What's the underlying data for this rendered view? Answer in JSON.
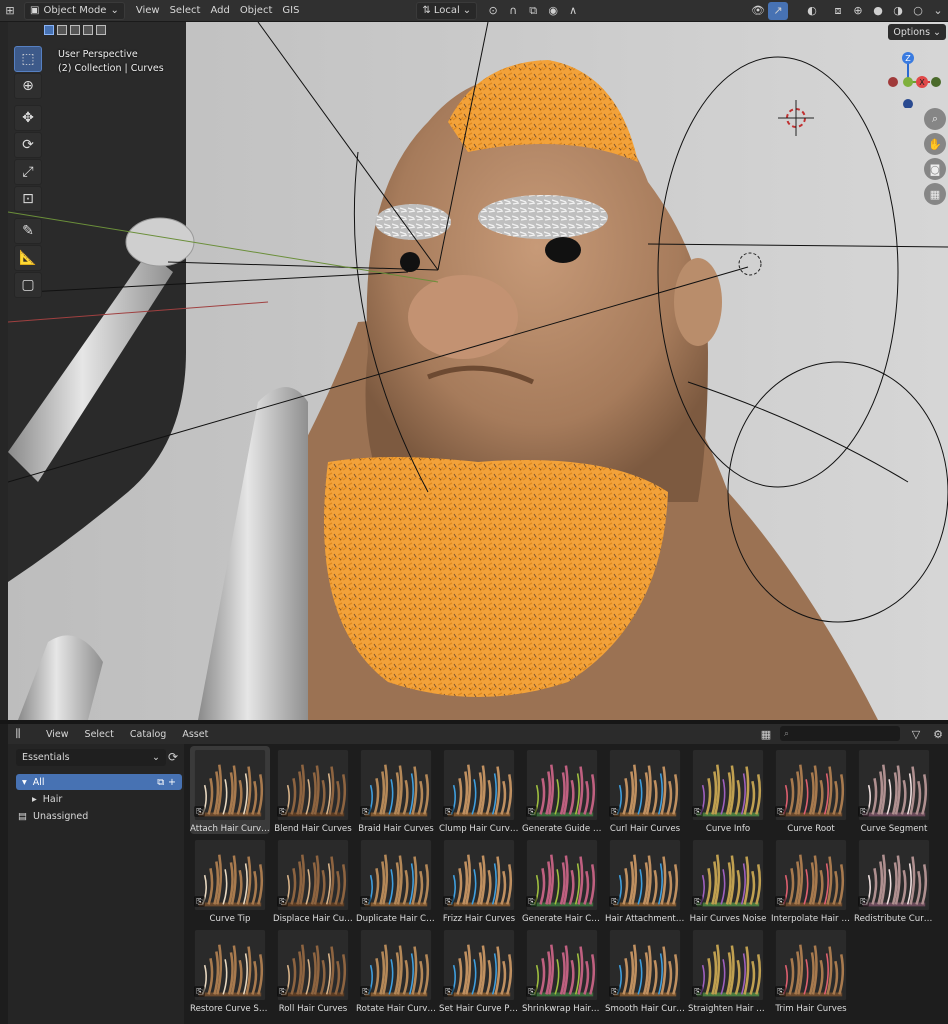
{
  "header": {
    "mode": "Object Mode",
    "menus": [
      "View",
      "Select",
      "Add",
      "Object",
      "GIS"
    ],
    "orientation": "Local"
  },
  "viewport": {
    "perspective": "User Perspective",
    "collection": "(2) Collection | Curves",
    "options_label": "Options",
    "gizmo_axes": [
      "X",
      "Y",
      "Z"
    ]
  },
  "asset_browser": {
    "menus": [
      "View",
      "Select",
      "Catalog",
      "Asset"
    ],
    "library": "Essentials",
    "catalogs": [
      {
        "label": "All",
        "active": true
      },
      {
        "label": "Hair",
        "active": false
      },
      {
        "label": "Unassigned",
        "active": false
      }
    ],
    "assets": [
      {
        "label": "Attach Hair Curves",
        "icon": "node-icon"
      },
      {
        "label": "Blend Hair Curves",
        "icon": "node-icon"
      },
      {
        "label": "Braid Hair Curves",
        "icon": "node-icon"
      },
      {
        "label": "Clump Hair Curves",
        "icon": "node-icon"
      },
      {
        "label": "Generate Guide Index",
        "icon": "node-icon"
      },
      {
        "label": "Curl Hair Curves",
        "icon": "node-icon"
      },
      {
        "label": "Curve Info",
        "icon": "node-icon"
      },
      {
        "label": "Curve Root",
        "icon": "node-icon"
      },
      {
        "label": "Curve Segment",
        "icon": "node-icon"
      },
      {
        "label": "Curve Tip",
        "icon": "node-icon"
      },
      {
        "label": "Displace Hair Curves",
        "icon": "node-icon"
      },
      {
        "label": "Duplicate Hair Curves",
        "icon": "node-icon"
      },
      {
        "label": "Frizz Hair Curves",
        "icon": "node-icon"
      },
      {
        "label": "Generate Hair Curves",
        "icon": "node-icon"
      },
      {
        "label": "Hair Attachment Info",
        "icon": "node-icon"
      },
      {
        "label": "Hair Curves Noise",
        "icon": "node-icon"
      },
      {
        "label": "Interpolate Hair Curves",
        "icon": "node-icon"
      },
      {
        "label": "Redistribute Curve Points",
        "icon": "node-icon"
      },
      {
        "label": "Restore Curve Segment Length",
        "icon": "node-icon"
      },
      {
        "label": "Roll Hair Curves",
        "icon": "node-icon"
      },
      {
        "label": "Rotate Hair Curves",
        "icon": "node-icon"
      },
      {
        "label": "Set Hair Curve Profile",
        "icon": "node-icon"
      },
      {
        "label": "Shrinkwrap Hair Curves",
        "icon": "node-icon"
      },
      {
        "label": "Smooth Hair Curves",
        "icon": "node-icon"
      },
      {
        "label": "Straighten Hair Curves",
        "icon": "node-icon"
      },
      {
        "label": "Trim Hair Curves",
        "icon": "node-icon"
      }
    ]
  }
}
